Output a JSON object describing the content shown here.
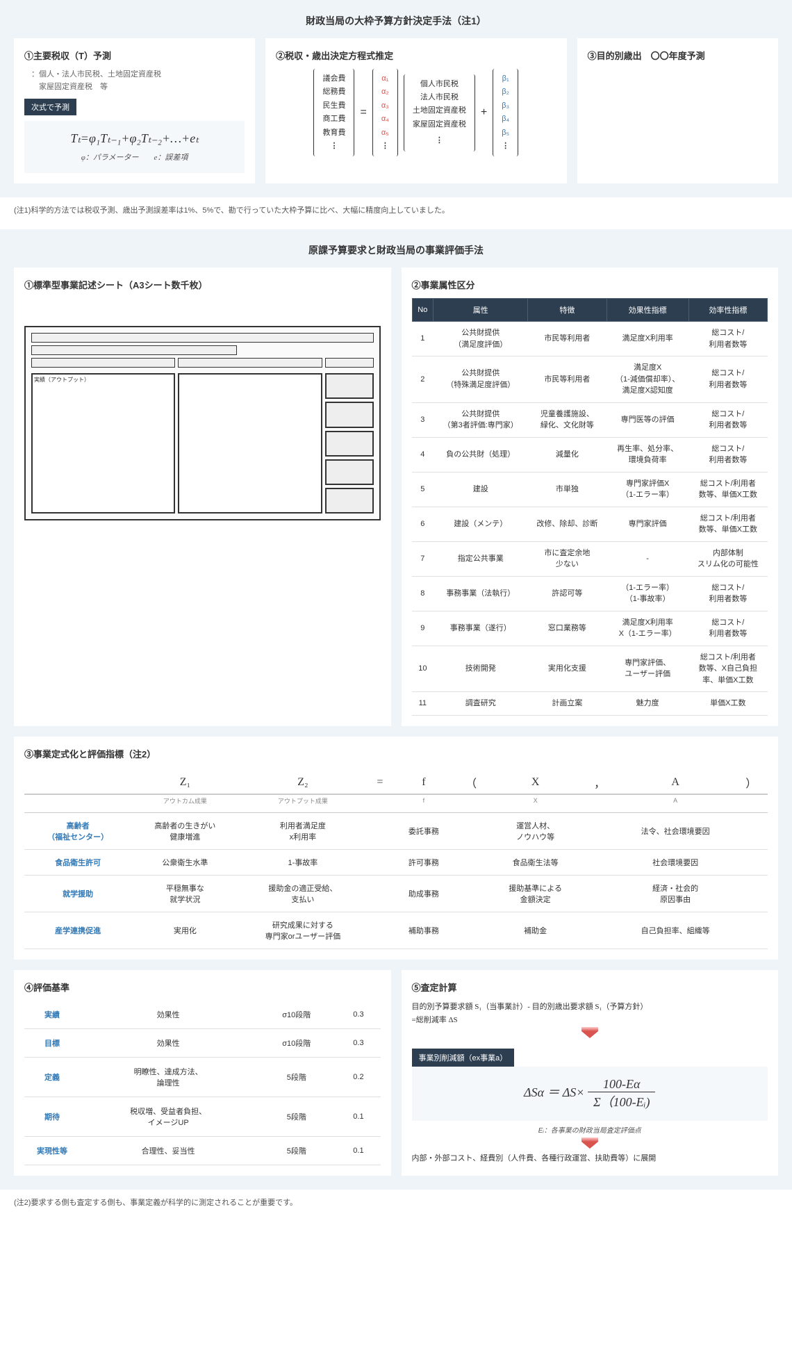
{
  "section1": {
    "title": "財政当局の大枠予算方針決定手法（注1）",
    "c1": {
      "title": "①主要税収（T）予測",
      "sub": "：個人・法人市民税、土地固定資産税\n　家屋固定資産税　等",
      "badge": "次式で予測",
      "eq": "Tₜ=φ₁Tₜ₋₁+φ₂Tₜ₋₂+…+eₜ",
      "eqnote": "φ：パラメーター　　e：誤差項"
    },
    "c2": {
      "title": "②税収・歳出決定方程式推定",
      "left": [
        "議会費",
        "総務費",
        "民生費",
        "商工費",
        "教育費",
        "⋮"
      ],
      "alpha": [
        "α₁",
        "α₂",
        "α₃",
        "α₄",
        "α₅",
        "⋮"
      ],
      "mid": [
        "個人市民税",
        "法人市民税",
        "土地固定資産税",
        "家屋固定資産税",
        "",
        "⋮"
      ],
      "beta": [
        "β₁",
        "β₂",
        "β₃",
        "β₄",
        "β₅",
        "⋮"
      ],
      "eq": "=",
      "plus": "+"
    },
    "c3": {
      "title": "③目的別歳出　〇〇年度予測"
    }
  },
  "note1": "(注1)科学的方法では税収予測、歳出予測誤差率は1%、5%で、勘で行っていた大枠予算に比べ、大幅に精度向上していました。",
  "section2": {
    "title": "原課予算要求と財政当局の事業評価手法",
    "c1": {
      "title": "①標準型事業記述シート（A3シート数千枚）"
    },
    "c2": {
      "title": "②事業属性区分",
      "headers": [
        "No",
        "属性",
        "特徴",
        "効果性指標",
        "効率性指標"
      ],
      "rows": [
        [
          "1",
          "公共財提供\n（満足度評価）",
          "市民等利用者",
          "満足度X利用率",
          "総コスト/\n利用者数等"
        ],
        [
          "2",
          "公共財提供\n（特殊満足度評価）",
          "市民等利用者",
          "満足度X\n（1-減価償却率）、\n満足度X認知度",
          "総コスト/\n利用者数等"
        ],
        [
          "3",
          "公共財提供\n（第3者評価:専門家）",
          "児童養護施設、\n緑化、文化財等",
          "専門医等の評価",
          "総コスト/\n利用者数等"
        ],
        [
          "4",
          "負の公共財（処理）",
          "減量化",
          "再生率、処分率、\n環境負荷率",
          "総コスト/\n利用者数等"
        ],
        [
          "5",
          "建設",
          "市単独",
          "専門家評価X\n（1-エラー率）",
          "総コスト/利用者\n数等、単価X工数"
        ],
        [
          "6",
          "建設（メンテ）",
          "改修、除却、診断",
          "専門家評価",
          "総コスト/利用者\n数等、単価X工数"
        ],
        [
          "7",
          "指定公共事業",
          "市に査定余地\n少ない",
          "-",
          "内部体制\nスリム化の可能性"
        ],
        [
          "8",
          "事務事業（法執行）",
          "許認可等",
          "（1-エラー率）\n（1-事故率）",
          "総コスト/\n利用者数等"
        ],
        [
          "9",
          "事務事業（遂行）",
          "窓口業務等",
          "満足度X利用率\nX（1-エラー率）",
          "総コスト/\n利用者数等"
        ],
        [
          "10",
          "技術開発",
          "実用化支援",
          "専門家評価、\nユーザー評価",
          "総コスト/利用者\n数等、X自己負担\n率、単価X工数"
        ],
        [
          "11",
          "調査研究",
          "計画立案",
          "魅力度",
          "単価X工数"
        ]
      ]
    },
    "c3": {
      "title": "③事業定式化と評価指標（注2）",
      "hdr": [
        "",
        "Z₁",
        "Z₂",
        "=",
        "f",
        "（",
        "X",
        "，",
        "A",
        "）"
      ],
      "sub": [
        "",
        "アウトカム成果",
        "アウトプット成果",
        "",
        "f",
        "",
        "X",
        "",
        "A",
        ""
      ],
      "rows": [
        [
          "高齢者\n（福祉センター）",
          "高齢者の生きがい\n健康増進",
          "利用者満足度\nx利用率",
          "",
          "委託事務",
          "",
          "運営人材、\nノウハウ等",
          "",
          "法令、社会環境要因",
          ""
        ],
        [
          "食品衛生許可",
          "公衆衛生水準",
          "1-事故率",
          "",
          "許可事務",
          "",
          "食品衛生法等",
          "",
          "社会環境要因",
          ""
        ],
        [
          "就学援助",
          "平穏無事な\n就学状況",
          "援助金の適正受給、\n支払い",
          "",
          "助成事務",
          "",
          "援助基準による\n金額決定",
          "",
          "経済・社会的\n原因事由",
          ""
        ],
        [
          "産学連携促進",
          "実用化",
          "研究成果に対する\n専門家orユーザー評価",
          "",
          "補助事務",
          "",
          "補助金",
          "",
          "自己負担率、組織等",
          ""
        ]
      ]
    },
    "c4": {
      "title": "④評価基準",
      "rows": [
        [
          "実績",
          "効果性",
          "σ10段階",
          "0.3"
        ],
        [
          "目標",
          "効果性",
          "σ10段階",
          "0.3"
        ],
        [
          "定義",
          "明瞭性、達成方法、\n論理性",
          "5段階",
          "0.2"
        ],
        [
          "期待",
          "税収増、受益者負担、\nイメージUP",
          "5段階",
          "0.1"
        ],
        [
          "実現性等",
          "合理性、妥当性",
          "5段階",
          "0.1"
        ]
      ]
    },
    "c5": {
      "title": "⑤査定計算",
      "line1": "目的別予算要求額 S₁（当事業計）- 目的別歳出要求額 S₁（予算方針）",
      "line2": "=総削減率 ΔS",
      "badge": "事業別削減額（ex事業a）",
      "formula_l": "ΔSα ＝ ΔS×",
      "formula_num": "100-Eα",
      "formula_den": "Σ（100-Eᵢ)",
      "enote": "Eᵢ：各事業の財政当局査定評価点",
      "expand": "内部・外部コスト、経費別（人件費、各種行政運営、扶助費等）に展開"
    }
  },
  "note2": "(注2)要求する側も査定する側も、事業定義が科学的に測定されることが重要です。"
}
